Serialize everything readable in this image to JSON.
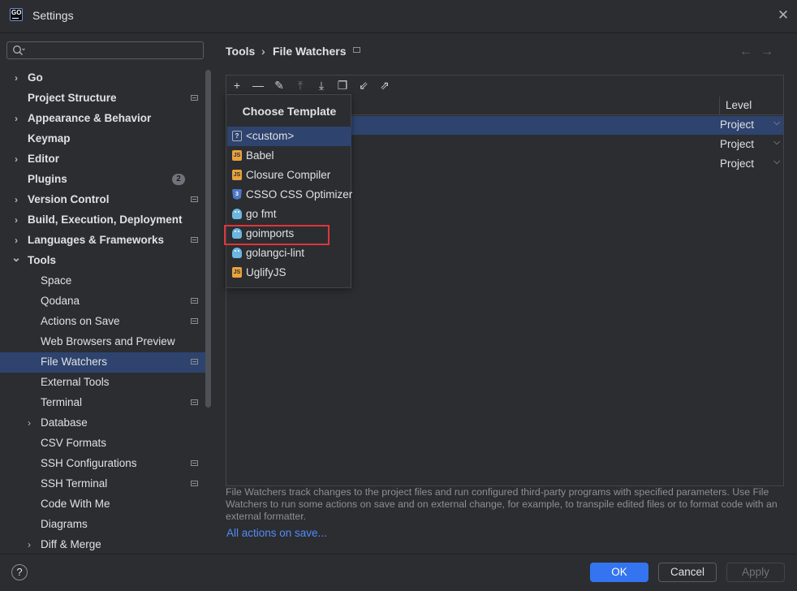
{
  "window": {
    "title": "Settings",
    "logo_text": "GO"
  },
  "search": {
    "value": ""
  },
  "sidebar": {
    "items": [
      {
        "label": "Go",
        "expandable": true,
        "expanded": false,
        "gear": false
      },
      {
        "label": "Project Structure",
        "expandable": false,
        "gear": true
      },
      {
        "label": "Appearance & Behavior",
        "expandable": true,
        "expanded": false,
        "gear": false
      },
      {
        "label": "Keymap",
        "expandable": false,
        "gear": false
      },
      {
        "label": "Editor",
        "expandable": true,
        "expanded": false,
        "gear": false
      },
      {
        "label": "Plugins",
        "expandable": false,
        "gear": false,
        "badge": "2"
      },
      {
        "label": "Version Control",
        "expandable": true,
        "expanded": false,
        "gear": true
      },
      {
        "label": "Build, Execution, Deployment",
        "expandable": true,
        "expanded": false,
        "gear": false
      },
      {
        "label": "Languages & Frameworks",
        "expandable": true,
        "expanded": false,
        "gear": true
      },
      {
        "label": "Tools",
        "expandable": true,
        "expanded": true,
        "gear": false
      },
      {
        "label": "Space",
        "child": true,
        "gear": false
      },
      {
        "label": "Qodana",
        "child": true,
        "gear": true
      },
      {
        "label": "Actions on Save",
        "child": true,
        "gear": true
      },
      {
        "label": "Web Browsers and Preview",
        "child": true,
        "gear": false
      },
      {
        "label": "File Watchers",
        "child": true,
        "gear": true,
        "selected": true
      },
      {
        "label": "External Tools",
        "child": true,
        "gear": false
      },
      {
        "label": "Terminal",
        "child": true,
        "gear": true
      },
      {
        "label": "Database",
        "child": true,
        "expandable": true,
        "gear": false
      },
      {
        "label": "CSV Formats",
        "child": true,
        "gear": false
      },
      {
        "label": "SSH Configurations",
        "child": true,
        "gear": true
      },
      {
        "label": "SSH Terminal",
        "child": true,
        "gear": true
      },
      {
        "label": "Code With Me",
        "child": true,
        "gear": false
      },
      {
        "label": "Diagrams",
        "child": true,
        "gear": false
      },
      {
        "label": "Diff & Merge",
        "child": true,
        "expandable": true,
        "gear": false
      }
    ]
  },
  "breadcrumb": {
    "parent": "Tools",
    "separator": "›",
    "current": "File Watchers"
  },
  "nav": {
    "back": "←",
    "forward": "→"
  },
  "toolbar": {
    "icons": [
      {
        "name": "add-icon",
        "glyph": "+",
        "disabled": false
      },
      {
        "name": "remove-icon",
        "glyph": "—",
        "disabled": false
      },
      {
        "name": "edit-icon",
        "glyph": "✎",
        "disabled": false
      },
      {
        "name": "move-up-icon",
        "glyph": "⤒",
        "disabled": true
      },
      {
        "name": "move-down-icon",
        "glyph": "⤓",
        "disabled": false
      },
      {
        "name": "copy-icon",
        "glyph": "❐",
        "disabled": false
      },
      {
        "name": "import-icon",
        "glyph": "⇙",
        "disabled": false
      },
      {
        "name": "export-icon",
        "glyph": "⇗",
        "disabled": false
      }
    ]
  },
  "table": {
    "level_header": "Level",
    "rows": [
      {
        "level": "Project",
        "selected": true
      },
      {
        "level": "Project",
        "selected": false
      },
      {
        "level": "Project",
        "selected": false
      }
    ]
  },
  "popup": {
    "title": "Choose Template",
    "items": [
      {
        "label": "<custom>",
        "icon": "custom",
        "icon_text": "?",
        "selected": true
      },
      {
        "label": "Babel",
        "icon": "js",
        "icon_text": "JS"
      },
      {
        "label": "Closure Compiler",
        "icon": "js",
        "icon_text": "JS"
      },
      {
        "label": "CSSO CSS Optimizer",
        "icon": "css",
        "icon_text": "3"
      },
      {
        "label": "go fmt",
        "icon": "go",
        "icon_text": ""
      },
      {
        "label": "goimports",
        "icon": "go",
        "icon_text": "",
        "highlighted": true
      },
      {
        "label": "golangci-lint",
        "icon": "go",
        "icon_text": ""
      },
      {
        "label": "UglifyJS",
        "icon": "js",
        "icon_text": "JS"
      }
    ]
  },
  "description": {
    "text": "File Watchers track changes to the project files and run configured third-party programs with specified parameters. Use File Watchers to run some actions on save and on external change, for example, to transpile edited files or to format code with an external formatter.",
    "link": "All actions on save..."
  },
  "buttons": {
    "help": "?",
    "ok": "OK",
    "cancel": "Cancel",
    "apply": "Apply"
  },
  "colors": {
    "accent": "#3574f0",
    "selection": "#2e436e",
    "highlight_box": "#e0343d",
    "link": "#548af7"
  }
}
